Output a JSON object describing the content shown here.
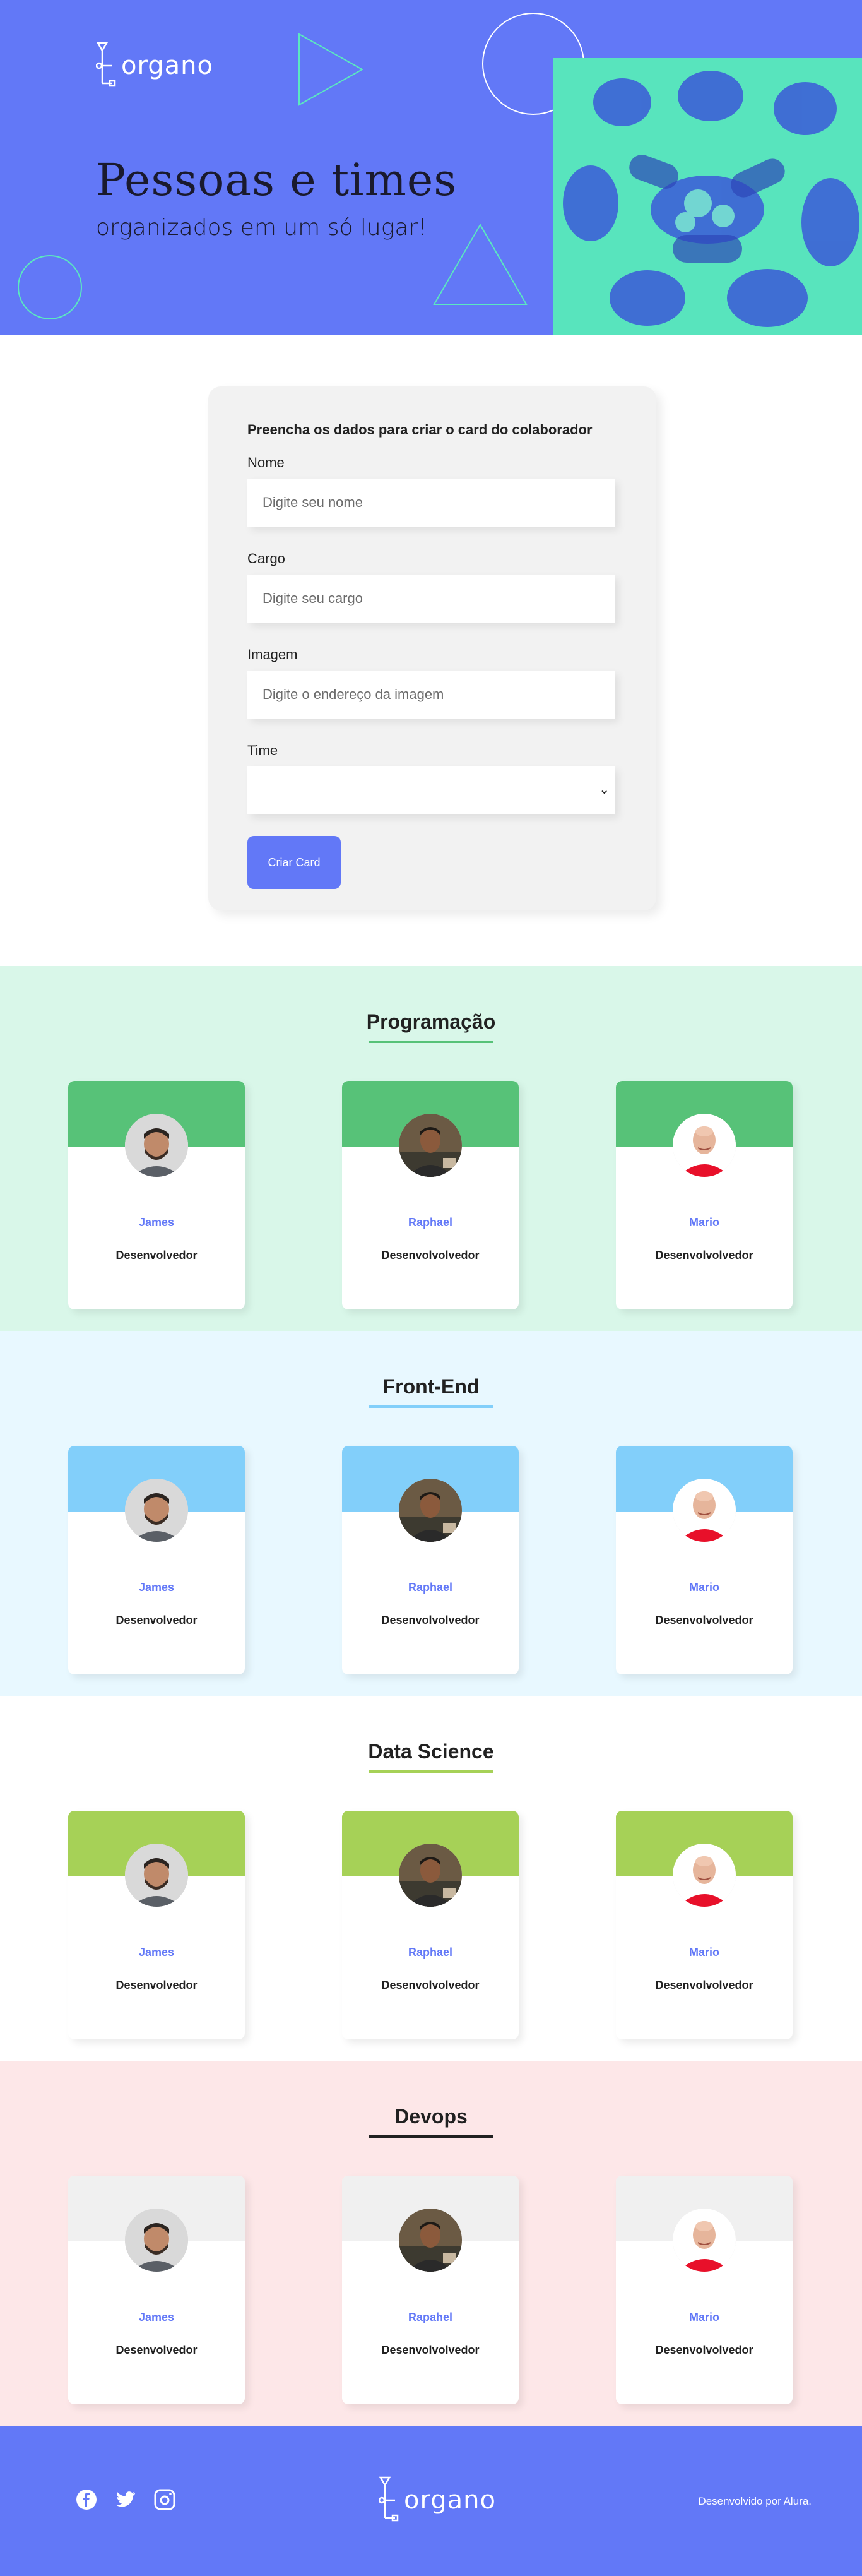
{
  "brand": {
    "logo_text": "organo"
  },
  "hero": {
    "title": "Pessoas e times",
    "subtitle": "organizados em um só lugar!",
    "background_color": "#6278F7",
    "photo_tint": "#5BE8C0"
  },
  "form": {
    "heading": "Preencha os dados para criar o card do colaborador",
    "fields": [
      {
        "label": "Nome",
        "placeholder": "Digite seu nome",
        "value": ""
      },
      {
        "label": "Cargo",
        "placeholder": "Digite seu cargo",
        "value": ""
      },
      {
        "label": "Imagem",
        "placeholder": "Digite o endereço da imagem",
        "value": ""
      }
    ],
    "select": {
      "label": "Time",
      "value": ""
    },
    "submit_label": "Criar Card",
    "accent": "#6278F7"
  },
  "teams": [
    {
      "name": "Programação",
      "background": "#D9F7E9",
      "primary": "#57C278",
      "members": [
        {
          "name": "James",
          "role": "Desenvolvedor"
        },
        {
          "name": "Raphael",
          "role": "Desenvolvolvedor"
        },
        {
          "name": "Mario",
          "role": "Desenvolvolvedor"
        }
      ]
    },
    {
      "name": "Front-End",
      "background": "#E8F8FF",
      "primary": "#82CFFA",
      "members": [
        {
          "name": "James",
          "role": "Desenvolvedor"
        },
        {
          "name": "Raphael",
          "role": "Desenvolvolvedor"
        },
        {
          "name": "Mario",
          "role": "Desenvolvolvedor"
        }
      ]
    },
    {
      "name": "Data Science",
      "background": "#FFFFFF",
      "primary": "#A6D157",
      "members": [
        {
          "name": "James",
          "role": "Desenvolvedor"
        },
        {
          "name": "Raphael",
          "role": "Desenvolvolvedor"
        },
        {
          "name": "Mario",
          "role": "Desenvolvolvedor"
        }
      ]
    },
    {
      "name": "Devops",
      "background": "#FDE7E8",
      "primary": "#212121",
      "card_header": "#F0F0F0",
      "members": [
        {
          "name": "James",
          "role": "Desenvolvedor"
        },
        {
          "name": "Rapahel",
          "role": "Desenvolvolvedor"
        },
        {
          "name": "Mario",
          "role": "Desenvolvolvedor"
        }
      ]
    }
  ],
  "footer": {
    "social_icons": [
      "facebook-icon",
      "twitter-icon",
      "instagram-icon"
    ],
    "credit": "Desenvolvido por Alura."
  }
}
